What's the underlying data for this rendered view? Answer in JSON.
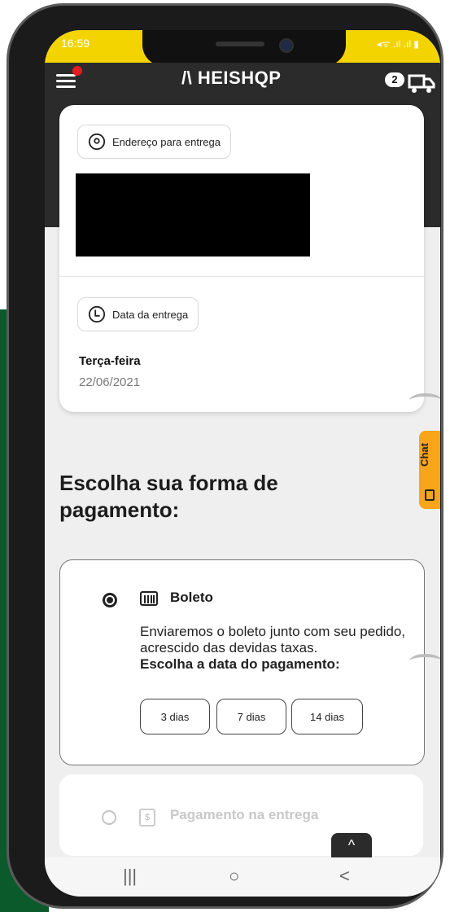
{
  "status": {
    "time": "16:59",
    "right_icons": "◂ᯤ .ıl .ıl ▮"
  },
  "header": {
    "logo": "HEISHQP",
    "cart_count": "2"
  },
  "address": {
    "label": "Endereço para entrega"
  },
  "delivery": {
    "label": "Data da entrega",
    "weekday": "Terça-feira",
    "date": "22/06/2021"
  },
  "payment": {
    "title": "Escolha sua forma de pagamento:",
    "boleto": {
      "label": "Boleto",
      "description": "Enviaremos o boleto junto com seu pedido, acrescido das devidas taxas.",
      "choose_date": "Escolha a data do pagamento:",
      "options": [
        "3 dias",
        "7 dias",
        "14 dias"
      ]
    },
    "cash": {
      "label": "Pagamento na entrega",
      "icon_glyph": "$"
    }
  },
  "chat": {
    "label": "Chat"
  },
  "scroll_up": {
    "glyph": "^"
  },
  "navbar": {
    "recent": "|||",
    "home": "○",
    "back": "<"
  }
}
